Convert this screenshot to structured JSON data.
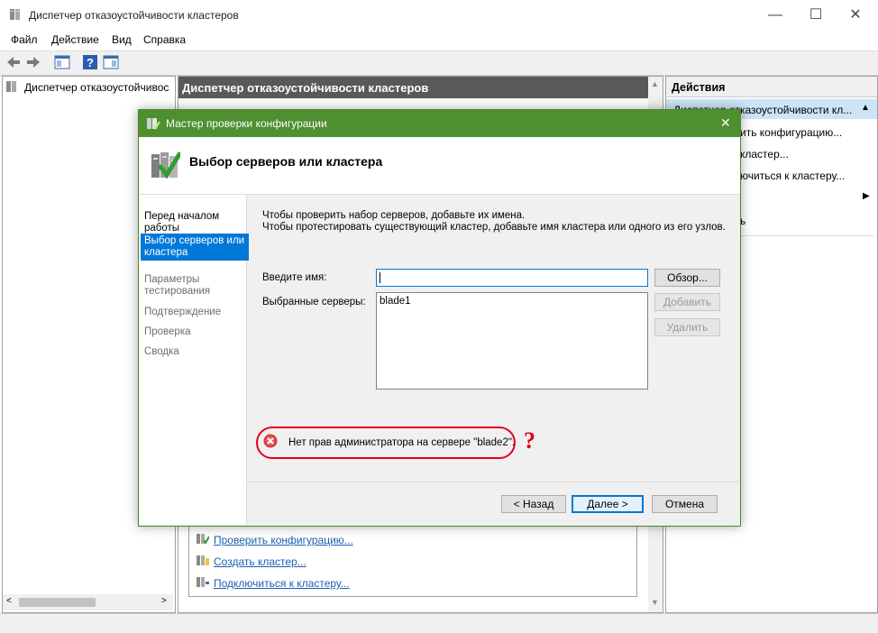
{
  "window": {
    "title": "Диспетчер отказоустойчивости кластеров",
    "menu": [
      "Файл",
      "Действие",
      "Вид",
      "Справка"
    ],
    "minimize": "—",
    "maximize": "☐",
    "close": "✕"
  },
  "tree": {
    "root_label": "Диспетчер отказоустойчивос"
  },
  "center": {
    "header": "Диспетчер отказоустойчивости кластеров",
    "links": [
      "Проверить конфигурацию...",
      "Создать кластер...",
      "Подключиться к кластеру..."
    ]
  },
  "actions": {
    "header": "Действия",
    "group_label": "Диспетчер отказоустойчивости кл...",
    "items": [
      "ить конфигурацию...",
      "кластер...",
      "ючиться к кластеру...",
      "",
      "ь"
    ]
  },
  "dialog": {
    "title": "Мастер проверки конфигурации",
    "heading": "Выбор серверов или кластера",
    "steps": [
      {
        "label": "Перед началом работы",
        "state": "normal"
      },
      {
        "label": "Выбор серверов или кластера",
        "state": "active"
      },
      {
        "label": "Параметры тестирования",
        "state": "disabled"
      },
      {
        "label": "Подтверждение",
        "state": "disabled"
      },
      {
        "label": "Проверка",
        "state": "disabled"
      },
      {
        "label": "Сводка",
        "state": "disabled"
      }
    ],
    "intro_line1": "Чтобы проверить набор серверов, добавьте их имена.",
    "intro_line2": "Чтобы протестировать существующий кластер, добавьте имя кластера или одного из его узлов.",
    "name_label": "Введите имя:",
    "name_value": "",
    "selected_label": "Выбранные серверы:",
    "selected_servers": [
      "blade1"
    ],
    "browse_button": "Обзор...",
    "add_button": "Добавить",
    "remove_button": "Удалить",
    "error_text": "Нет прав администратора на сервере \"blade2\".",
    "annotation_mark": "?",
    "back_button": "< Назад",
    "next_button": "Далее >",
    "cancel_button": "Отмена",
    "close": "✕"
  },
  "colors": {
    "dialog_title": "#4e8f2f",
    "active_step": "#0078d7",
    "error_outline": "#e0001b",
    "link": "#1a5fb4"
  }
}
